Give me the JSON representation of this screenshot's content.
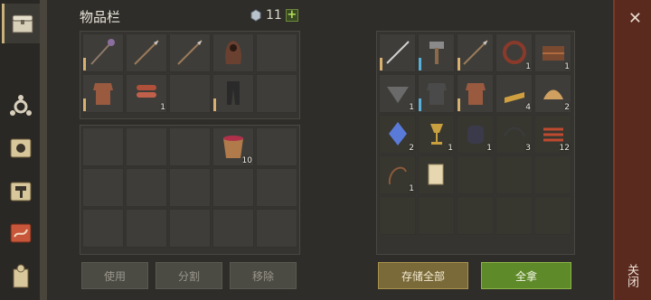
{
  "inventory": {
    "title": "物品栏",
    "currency_count": "11",
    "plus_label": "+",
    "rows": [
      [
        {
          "icon": "mace-icon",
          "qty": "",
          "bar": "gold"
        },
        {
          "icon": "spear-icon",
          "qty": "",
          "bar": ""
        },
        {
          "icon": "spear-icon",
          "qty": "",
          "bar": ""
        },
        {
          "icon": "hooded-cloak-icon",
          "qty": "",
          "bar": ""
        },
        {
          "icon": "",
          "qty": "",
          "bar": ""
        }
      ],
      [
        {
          "icon": "leather-armor-icon",
          "qty": "",
          "bar": "gold"
        },
        {
          "icon": "leather-strips-icon",
          "qty": "1",
          "bar": ""
        },
        {
          "icon": "",
          "qty": "",
          "bar": ""
        },
        {
          "icon": "leather-pants-icon",
          "qty": "",
          "bar": "gold"
        },
        {
          "icon": "",
          "qty": "",
          "bar": ""
        }
      ]
    ],
    "storage_rows": [
      [
        {
          "icon": "",
          "qty": ""
        },
        {
          "icon": "",
          "qty": ""
        },
        {
          "icon": "",
          "qty": ""
        },
        {
          "icon": "bucket-icon",
          "qty": "10"
        },
        {
          "icon": "",
          "qty": ""
        }
      ],
      [
        {
          "icon": "",
          "qty": ""
        },
        {
          "icon": "",
          "qty": ""
        },
        {
          "icon": "",
          "qty": ""
        },
        {
          "icon": "",
          "qty": ""
        },
        {
          "icon": "",
          "qty": ""
        }
      ],
      [
        {
          "icon": "",
          "qty": ""
        },
        {
          "icon": "",
          "qty": ""
        },
        {
          "icon": "",
          "qty": ""
        },
        {
          "icon": "",
          "qty": ""
        },
        {
          "icon": "",
          "qty": ""
        }
      ]
    ],
    "buttons": {
      "use": "使用",
      "split": "分割",
      "remove": "移除"
    }
  },
  "chest": {
    "rows": [
      [
        {
          "icon": "sword-icon",
          "qty": "",
          "bar": "gold"
        },
        {
          "icon": "hammer-icon",
          "qty": "",
          "bar": "blue"
        },
        {
          "icon": "spear-icon",
          "qty": "",
          "bar": "gold"
        },
        {
          "icon": "collar-icon",
          "qty": "1",
          "bar": ""
        },
        {
          "icon": "chest-trap-icon",
          "qty": "1",
          "bar": ""
        }
      ],
      [
        {
          "icon": "crossbow-icon",
          "qty": "1",
          "bar": ""
        },
        {
          "icon": "chainmail-icon",
          "qty": "",
          "bar": "blue"
        },
        {
          "icon": "leather-armor-icon",
          "qty": "",
          "bar": "gold"
        },
        {
          "icon": "bar-icon",
          "qty": "4",
          "bar": ""
        },
        {
          "icon": "herb-icon",
          "qty": "2",
          "bar": ""
        }
      ],
      [
        {
          "icon": "crystal-icon",
          "qty": "2",
          "bar": ""
        },
        {
          "icon": "goblet-icon",
          "qty": "1",
          "bar": ""
        },
        {
          "icon": "gloves-icon",
          "qty": "1",
          "bar": ""
        },
        {
          "icon": "rope-icon",
          "qty": "3",
          "bar": ""
        },
        {
          "icon": "ribs-icon",
          "qty": "12",
          "bar": ""
        }
      ],
      [
        {
          "icon": "whip-icon",
          "qty": "1",
          "bar": ""
        },
        {
          "icon": "scroll-icon",
          "qty": "",
          "bar": ""
        },
        {
          "icon": "",
          "qty": "",
          "bar": ""
        },
        {
          "icon": "",
          "qty": "",
          "bar": ""
        },
        {
          "icon": "",
          "qty": "",
          "bar": ""
        }
      ],
      [
        {
          "icon": "",
          "qty": "",
          "bar": ""
        },
        {
          "icon": "",
          "qty": "",
          "bar": ""
        },
        {
          "icon": "",
          "qty": "",
          "bar": ""
        },
        {
          "icon": "",
          "qty": "",
          "bar": ""
        },
        {
          "icon": "",
          "qty": "",
          "bar": ""
        }
      ]
    ],
    "buttons": {
      "store_all": "存储全部",
      "take_all": "全拿"
    }
  },
  "close": {
    "label": "关闭"
  },
  "side_tabs": [
    "chest-icon",
    "crafting-icon",
    "sun-book-icon",
    "hammer-map-icon",
    "scroll-map-icon",
    "building-icon"
  ]
}
